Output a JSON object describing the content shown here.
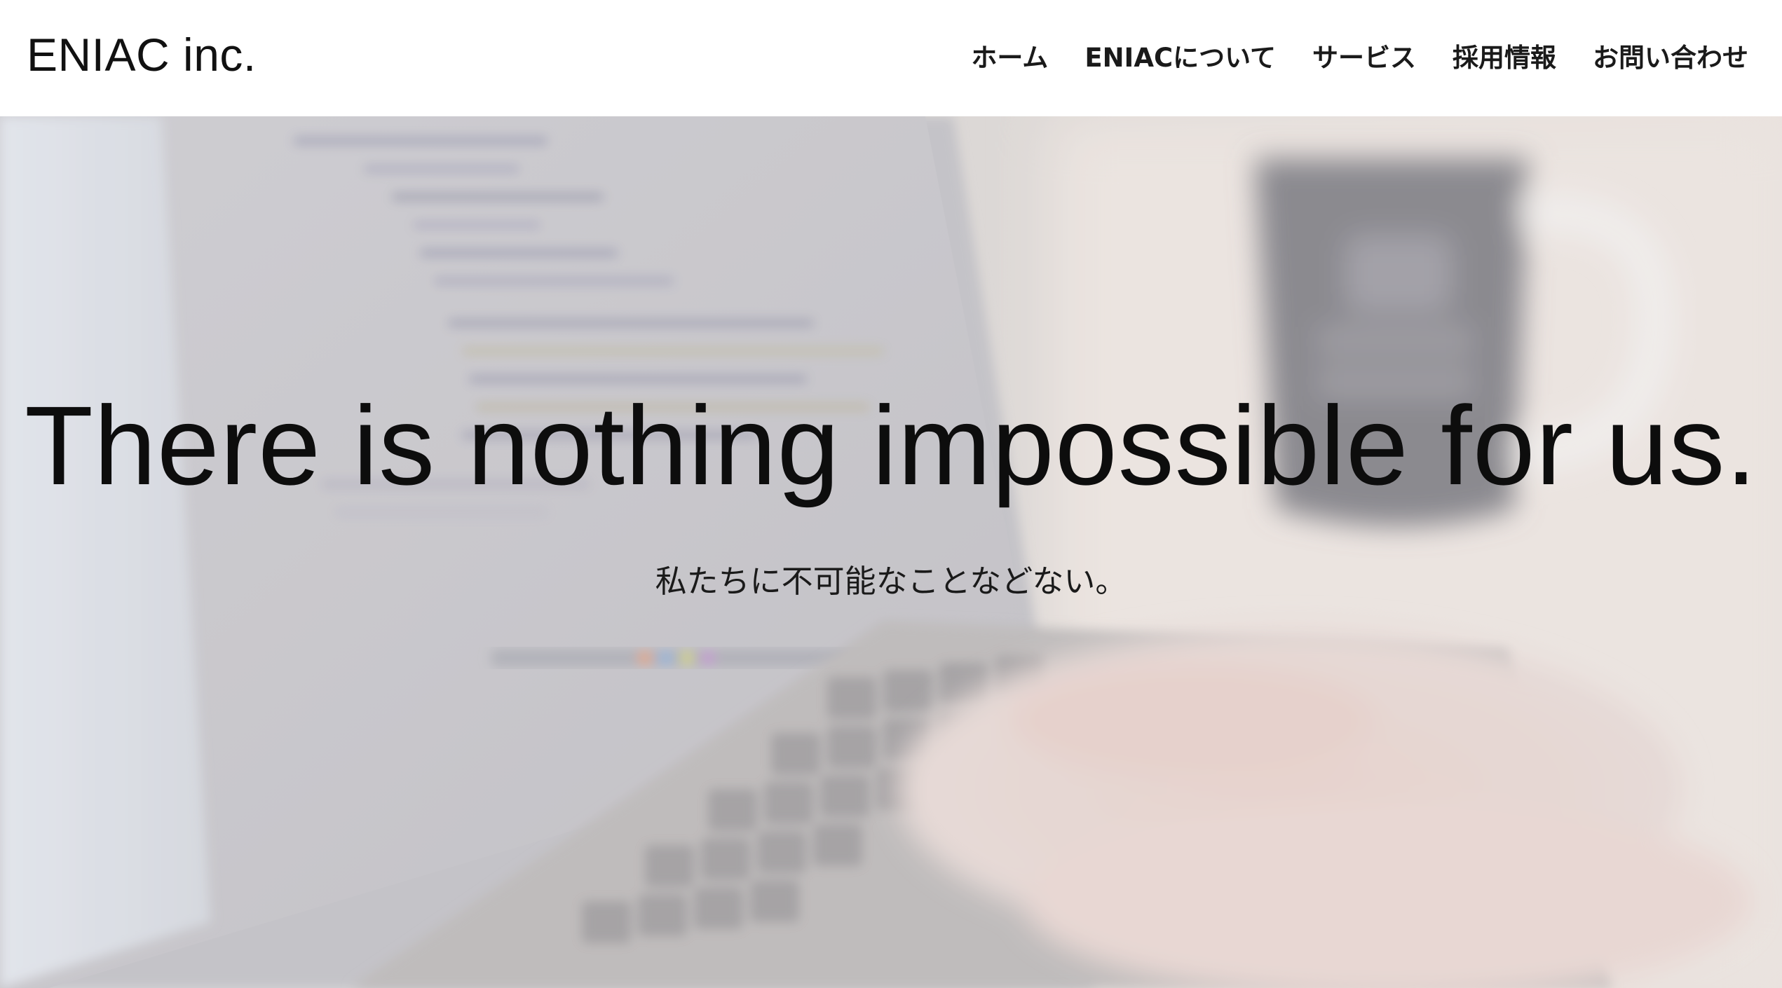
{
  "header": {
    "logo": "ENIAC inc.",
    "nav": [
      {
        "label": "ホーム"
      },
      {
        "label": "ENIACについて"
      },
      {
        "label": "サービス"
      },
      {
        "label": "採用情報"
      },
      {
        "label": "お問い合わせ"
      }
    ]
  },
  "hero": {
    "background_image": "blurred-laptop-code-coffee-photo",
    "title": "There is nothing impossible for us.",
    "subtitle": "私たちに不可能なことなどない。"
  }
}
